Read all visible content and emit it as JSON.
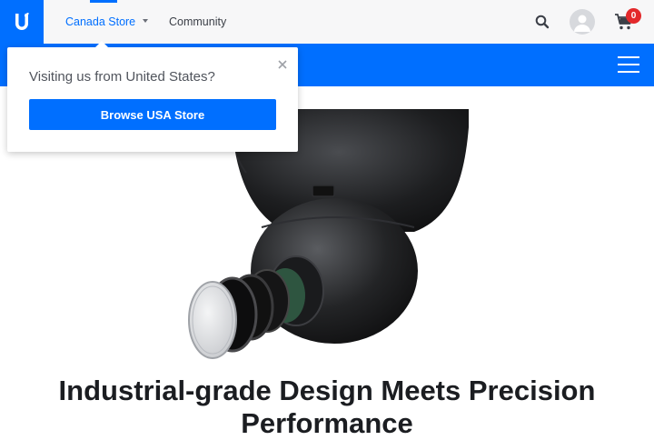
{
  "topbar": {
    "store_label": "Canada Store",
    "community_label": "Community",
    "cart_count": "0",
    "icons": {
      "logo": "ubiquiti-u-logo",
      "search": "search-icon",
      "account": "user-icon",
      "cart": "cart-icon"
    }
  },
  "subnav": {
    "menu_icon": "hamburger-menu-icon"
  },
  "popup": {
    "message": "Visiting us from United States?",
    "button_label": "Browse USA Store",
    "close_icon": "close-icon"
  },
  "hero": {
    "image": "ptz-camera-product-image",
    "headline": "Industrial-grade Design Meets Precision Performance"
  },
  "colors": {
    "accent": "#006fff",
    "badge": "#e3292b",
    "topbar_bg": "#f7f7f8",
    "headline": "#1b1d21"
  }
}
